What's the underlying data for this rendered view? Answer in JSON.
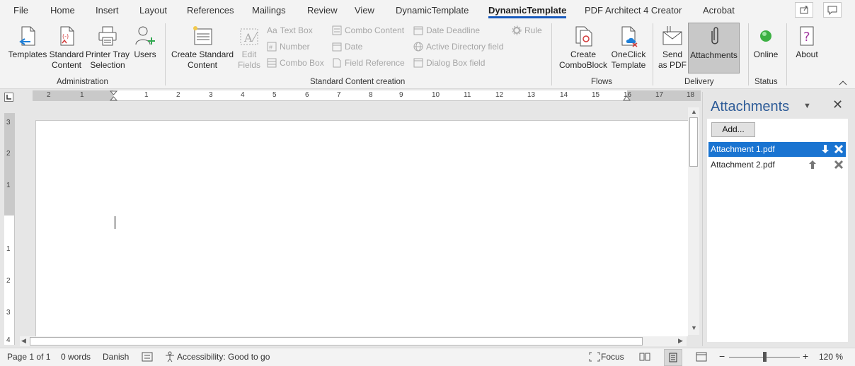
{
  "tabs": [
    "File",
    "Home",
    "Insert",
    "Layout",
    "References",
    "Mailings",
    "Review",
    "View",
    "DynamicTemplate",
    "DynamicTemplate",
    "PDF Architect 4 Creator",
    "Acrobat"
  ],
  "active_tab_index": 9,
  "ribbon": {
    "administration": {
      "label": "Administration",
      "templates": "Templates",
      "standard_content": [
        "Standard",
        "Content"
      ],
      "printer_tray": [
        "Printer Tray",
        "Selection"
      ],
      "users": "Users"
    },
    "standard_content_creation": {
      "label": "Standard Content creation",
      "create_standard": [
        "Create Standard",
        "Content"
      ],
      "edit_fields": [
        "Edit",
        "Fields"
      ],
      "text_box": "Text Box",
      "number": "Number",
      "combo_box": "Combo Box",
      "combo_content": "Combo Content",
      "date": "Date",
      "field_reference": "Field Reference",
      "date_deadline": "Date Deadline",
      "active_directory": "Active Directory field",
      "dialog_box": "Dialog Box field",
      "rule": "Rule"
    },
    "flows": {
      "label": "Flows",
      "create_comboblock": [
        "Create",
        "ComboBlock"
      ],
      "oneclick": [
        "OneClick",
        "Template"
      ]
    },
    "delivery": {
      "label": "Delivery",
      "send_pdf": [
        "Send",
        "as PDF"
      ],
      "attachments": "Attachments"
    },
    "status": {
      "label": "Status",
      "online": "Online"
    },
    "about": "About"
  },
  "ruler": {
    "h_numbers": [
      "2",
      "1",
      "1",
      "2",
      "3",
      "4",
      "5",
      "6",
      "7",
      "8",
      "9",
      "10",
      "11",
      "12",
      "13",
      "14",
      "15",
      "16",
      "17",
      "18"
    ],
    "v_numbers": [
      "3",
      "2",
      "1",
      "1",
      "2",
      "3",
      "4"
    ]
  },
  "pane": {
    "title": "Attachments",
    "add_button": "Add...",
    "attachments": [
      {
        "name": "Attachment 1.pdf",
        "selected": true
      },
      {
        "name": "Attachment 2.pdf",
        "selected": false
      }
    ]
  },
  "status": {
    "page": "Page 1 of 1",
    "words": "0 words",
    "language": "Danish",
    "accessibility": "Accessibility: Good to go",
    "focus": "Focus",
    "zoom": "120 %"
  },
  "colors": {
    "accent": "#185abd",
    "selection": "#1a74d1",
    "pane_title": "#2e5c98",
    "online": "#3cb043"
  }
}
